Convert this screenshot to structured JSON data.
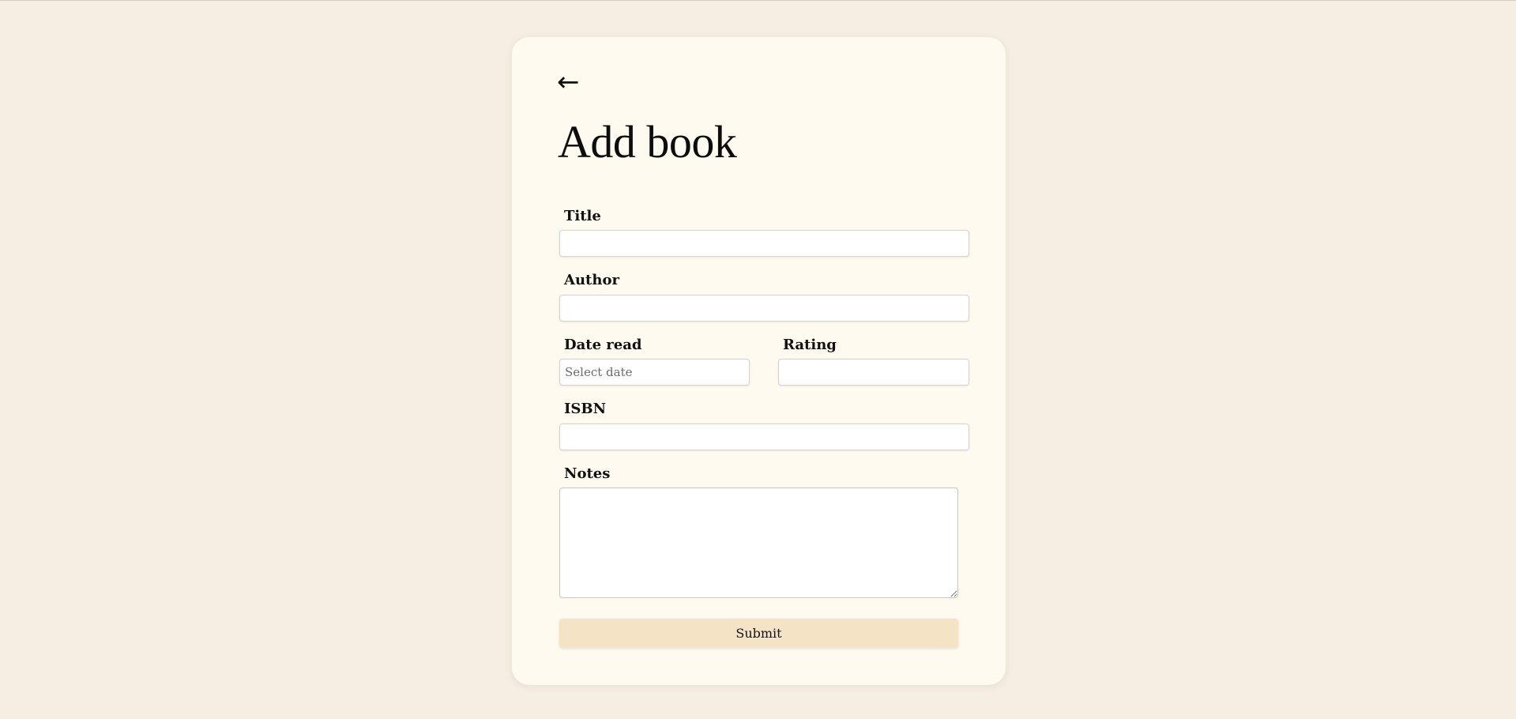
{
  "header": {
    "back_icon": "←",
    "title": "Add book"
  },
  "form": {
    "title_label": "Title",
    "title_value": "",
    "author_label": "Author",
    "author_value": "",
    "date_read_label": "Date read",
    "date_read_placeholder": "Select date",
    "date_read_value": "",
    "rating_label": "Rating",
    "rating_value": "",
    "isbn_label": "ISBN",
    "isbn_value": "",
    "notes_label": "Notes",
    "notes_value": "",
    "submit_label": "Submit"
  },
  "colors": {
    "page_background": "#f6eee3",
    "card_background": "#fefaef",
    "submit_background": "#f5e3c6"
  },
  "icons": {
    "back": "arrow-left-icon"
  }
}
